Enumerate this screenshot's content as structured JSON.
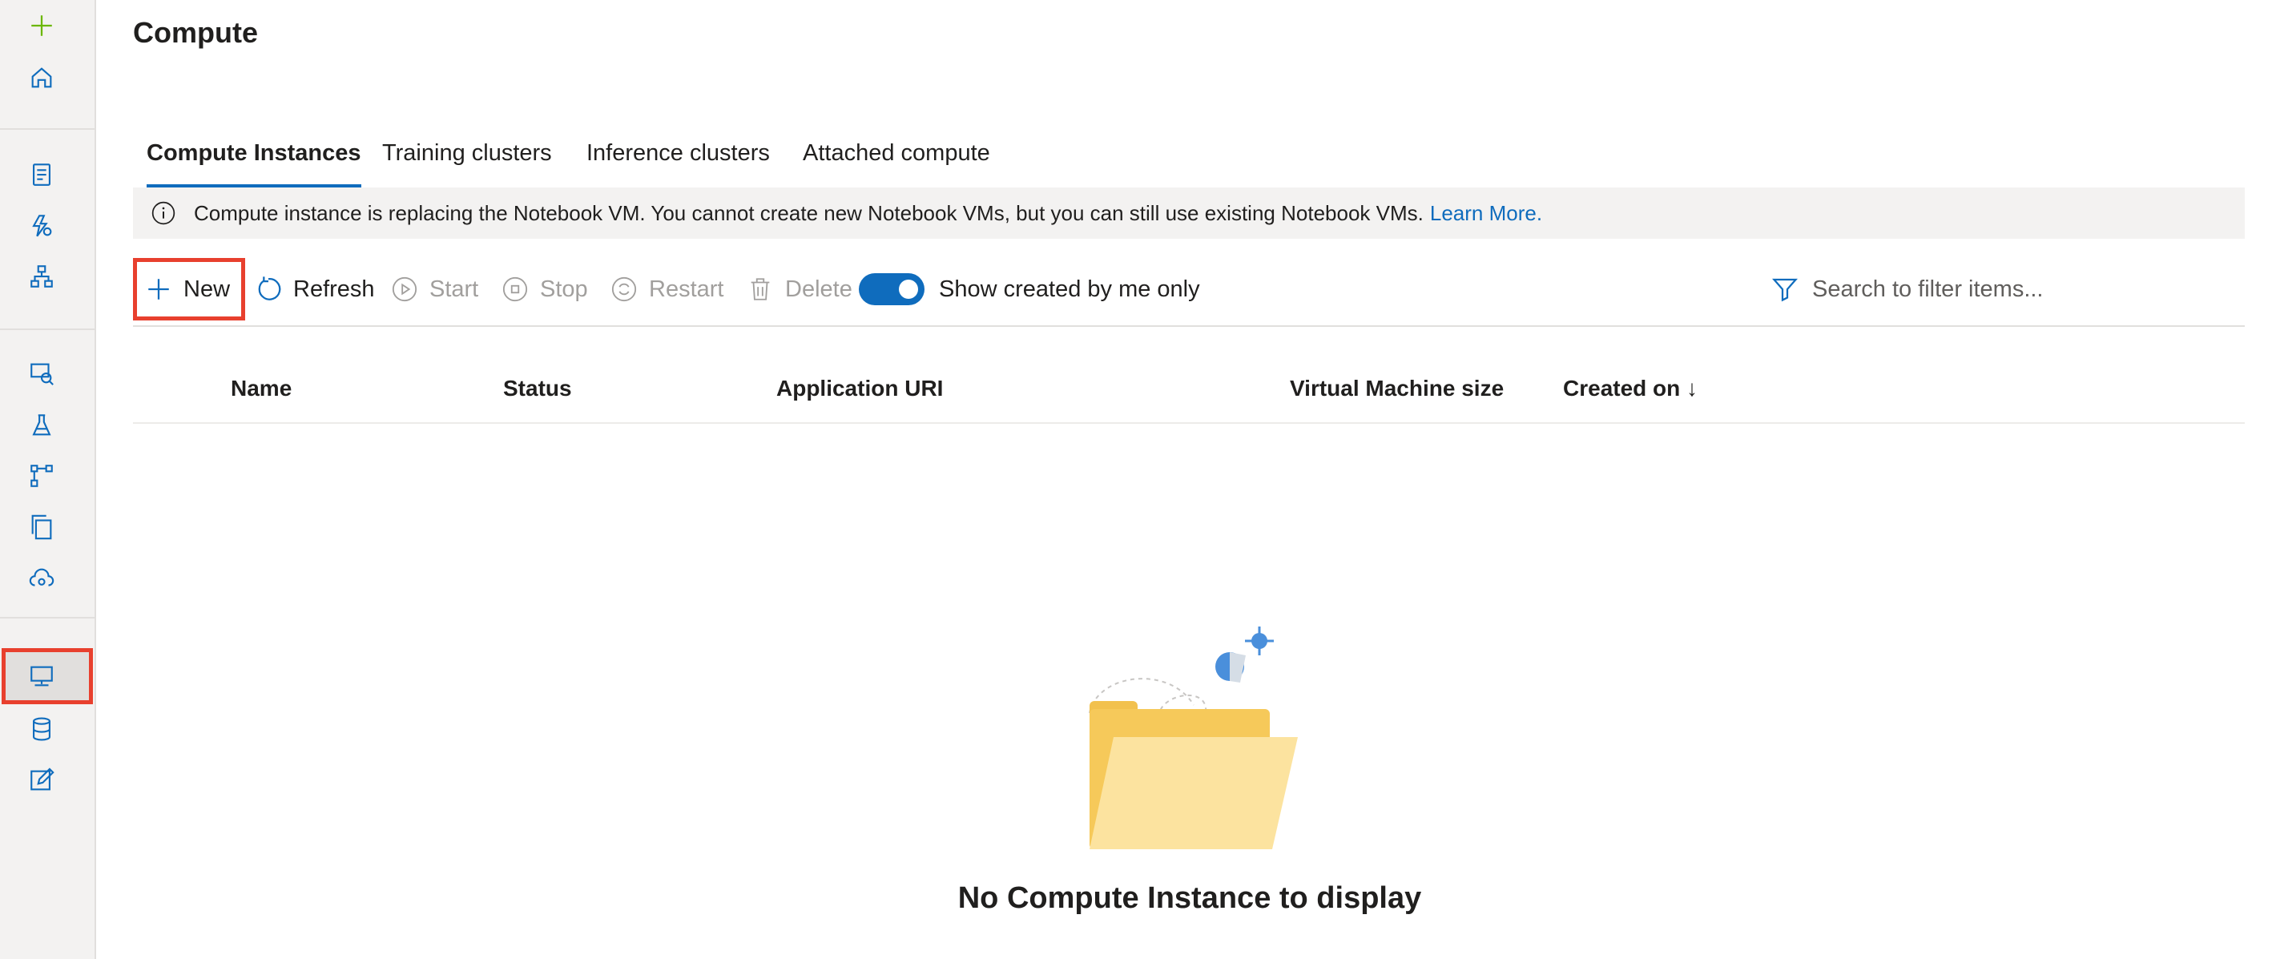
{
  "page": {
    "title": "Compute"
  },
  "tabs": [
    {
      "label": "Compute Instances",
      "active": true
    },
    {
      "label": "Training clusters",
      "active": false
    },
    {
      "label": "Inference clusters",
      "active": false
    },
    {
      "label": "Attached compute",
      "active": false
    }
  ],
  "infobar": {
    "message": "Compute instance is replacing the Notebook VM. You cannot create new Notebook VMs, but you can still use existing Notebook VMs.",
    "link": "Learn More."
  },
  "toolbar": {
    "new": "New",
    "refresh": "Refresh",
    "start": "Start",
    "stop": "Stop",
    "restart": "Restart",
    "delete": "Delete",
    "toggle_label": "Show created by me only",
    "toggle_on": true,
    "search_placeholder": "Search to filter items..."
  },
  "grid": {
    "columns": [
      "Name",
      "Status",
      "Application URI",
      "Virtual Machine size",
      "Created on ↓"
    ],
    "rows": []
  },
  "empty_state": {
    "message": "No Compute Instance to display"
  },
  "sidebar": {
    "icons": [
      "add-icon",
      "home-icon",
      "notebooks-icon",
      "automl-icon",
      "designer-icon",
      "datasets-icon",
      "experiments-icon",
      "pipelines-icon",
      "models-icon",
      "endpoints-icon",
      "compute-icon",
      "datastores-icon",
      "data-labeling-icon"
    ],
    "selected": "compute-icon"
  },
  "colors": {
    "accent": "#0f6cbd",
    "highlight": "#e8402e",
    "add": "#6bb700"
  }
}
